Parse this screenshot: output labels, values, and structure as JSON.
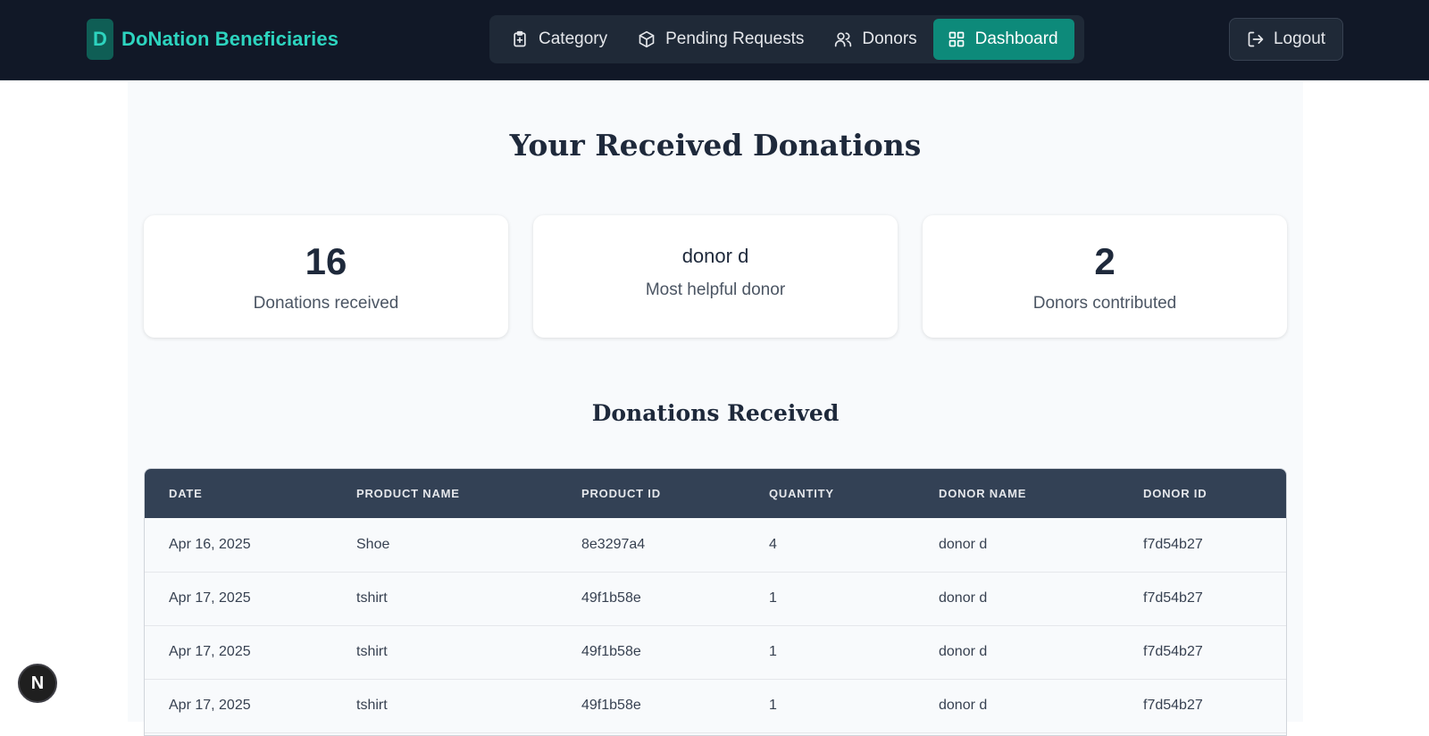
{
  "brand": {
    "badge": "D",
    "name": "DoNation Beneficiaries"
  },
  "nav": {
    "items": [
      {
        "label": "Category",
        "icon": "clipboard-icon"
      },
      {
        "label": "Pending Requests",
        "icon": "package-icon"
      },
      {
        "label": "Donors",
        "icon": "users-icon"
      },
      {
        "label": "Dashboard",
        "icon": "dashboard-icon",
        "active": true
      }
    ],
    "logout_label": "Logout"
  },
  "main": {
    "title": "Your Received Donations",
    "stats": {
      "donations": {
        "value": "16",
        "label": "Donations received"
      },
      "top_donor": {
        "name": "donor d",
        "label": "Most helpful donor"
      },
      "donors": {
        "value": "2",
        "label": "Donors contributed"
      }
    },
    "table_title": "Donations Received",
    "table": {
      "headers": [
        "Date",
        "Product Name",
        "Product ID",
        "Quantity",
        "Donor Name",
        "Donor ID"
      ],
      "rows": [
        [
          "Apr 16, 2025",
          "Shoe",
          "8e3297a4",
          "4",
          "donor d",
          "f7d54b27"
        ],
        [
          "Apr 17, 2025",
          "tshirt",
          "49f1b58e",
          "1",
          "donor d",
          "f7d54b27"
        ],
        [
          "Apr 17, 2025",
          "tshirt",
          "49f1b58e",
          "1",
          "donor d",
          "f7d54b27"
        ],
        [
          "Apr 17, 2025",
          "tshirt",
          "49f1b58e",
          "1",
          "donor d",
          "f7d54b27"
        ]
      ]
    }
  },
  "floating_badge": "N",
  "colors": {
    "accent": "#0d8a7a",
    "brand": "#2dd4bf",
    "navbar": "#111827",
    "table_header": "#334155"
  }
}
